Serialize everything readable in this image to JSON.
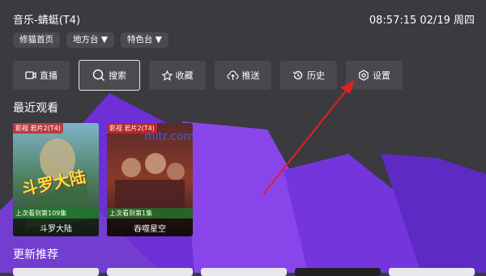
{
  "header": {
    "title": "音乐-蜻蜓(T4)",
    "clock": "08:57:15 02/19 周四"
  },
  "chips": [
    {
      "label": "修猫首页"
    },
    {
      "label": "地方台 ▼"
    },
    {
      "label": "特色台 ▼"
    }
  ],
  "nav": [
    {
      "label": "直播",
      "icon": "tv-icon"
    },
    {
      "label": "搜索",
      "icon": "search-icon"
    },
    {
      "label": "收藏",
      "icon": "star-icon"
    },
    {
      "label": "推送",
      "icon": "cloud-upload-icon"
    },
    {
      "label": "历史",
      "icon": "history-icon"
    },
    {
      "label": "设置",
      "icon": "gear-icon"
    }
  ],
  "sections": {
    "recent": "最近观看",
    "updates": "更新推荐"
  },
  "recent_items": [
    {
      "tag": "影视 若片2(T4)",
      "progress": "上次看到第109集",
      "name": "斗罗大陆",
      "poster_text": "斗罗大陆"
    },
    {
      "tag": "影视 若片2(T4)",
      "progress": "上次看到第1集",
      "name": "吞噬星空",
      "poster_text": ""
    }
  ],
  "watermark": "mitr.com",
  "colors": {
    "accent": "#7a35e0",
    "arrow": "#e02020",
    "background": "#3a3a3f"
  }
}
